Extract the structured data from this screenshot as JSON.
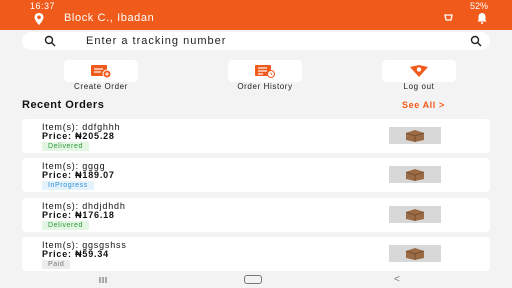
{
  "status_bar": {
    "time": "16:37",
    "battery": "52%"
  },
  "header": {
    "location": "Block C., Ibadan"
  },
  "search": {
    "placeholder": "Enter a tracking number"
  },
  "actions": [
    {
      "label": "Create Order",
      "icon": "create-order-icon"
    },
    {
      "label": "Order History",
      "icon": "order-history-icon"
    },
    {
      "label": "Log out",
      "icon": "logout-icon"
    }
  ],
  "recent": {
    "title": "Recent Orders",
    "see_all": "See All >"
  },
  "orders": [
    {
      "items": "Item(s): ddfghhh",
      "price": "Price: ₦205.28",
      "status": "Delivered"
    },
    {
      "items": "Item(s): gggg",
      "price": "Price: ₦189.07",
      "status": "InProgress"
    },
    {
      "items": "Item(s): dhdjdhdh",
      "price": "Price: ₦176.18",
      "status": "Delivered"
    },
    {
      "items": "Item(s): ggsgshss",
      "price": "Price: ₦59.34",
      "status": "Paid"
    }
  ],
  "colors": {
    "accent": "#f05a1a",
    "background": "#f3f3f3"
  }
}
